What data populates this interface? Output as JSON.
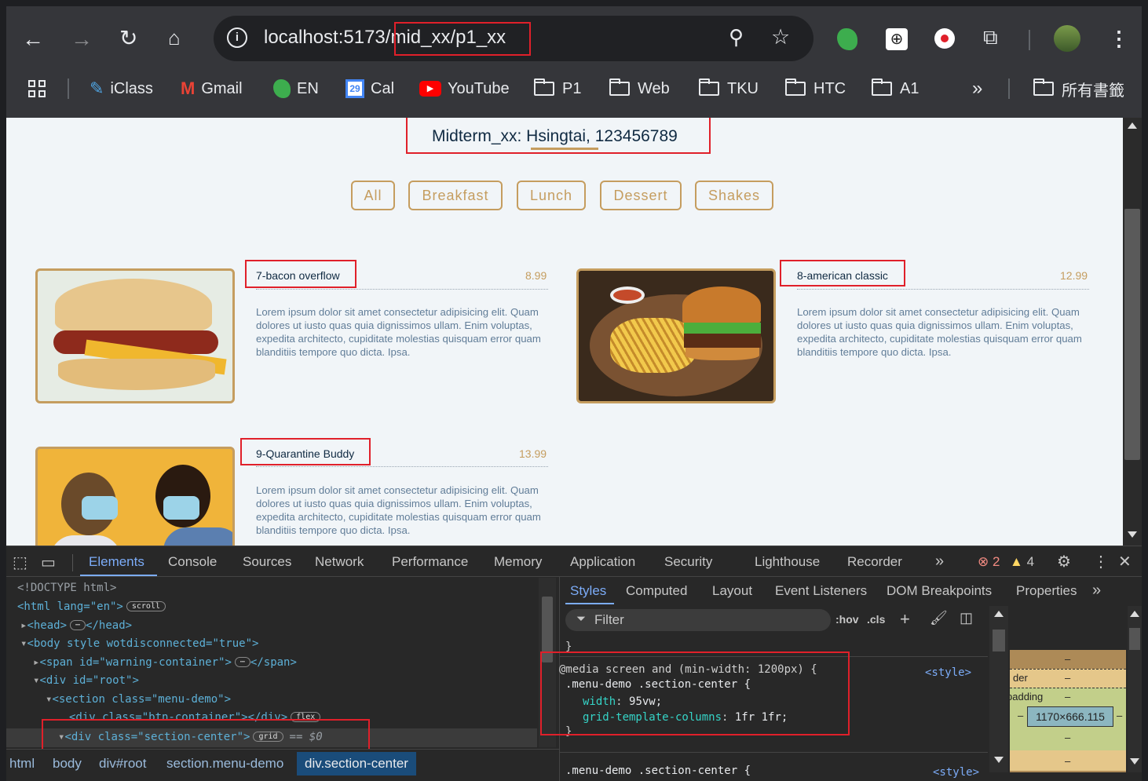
{
  "browser": {
    "url": "localhost:5173/mid_xx/p1_xx",
    "bookmarks": [
      {
        "label": "iClass",
        "icon": "iclass-icon"
      },
      {
        "label": "Gmail",
        "icon": "gmail-icon"
      },
      {
        "label": "EN",
        "icon": "evernote-icon"
      },
      {
        "label": "Cal",
        "icon": "calendar-icon",
        "badge": "29"
      },
      {
        "label": "YouTube",
        "icon": "youtube-icon"
      },
      {
        "label": "P1",
        "icon": "folder-icon"
      },
      {
        "label": "Web",
        "icon": "folder-icon"
      },
      {
        "label": "TKU",
        "icon": "folder-icon"
      },
      {
        "label": "HTC",
        "icon": "folder-icon"
      },
      {
        "label": "A1",
        "icon": "folder-icon"
      }
    ],
    "overflow": "»",
    "all_bookmarks": "所有書籤"
  },
  "page": {
    "title": "Midterm_xx: Hsingtai, 123456789",
    "filters": [
      "All",
      "Breakfast",
      "Lunch",
      "Dessert",
      "Shakes"
    ],
    "items": [
      {
        "title": "7-bacon overflow",
        "price": "8.99",
        "desc": "Lorem ipsum dolor sit amet consectetur adipisicing elit. Quam dolores ut iusto quas quia dignissimos ullam. Enim voluptas, expedita architecto, cupiditate molestias quisquam error quam blanditiis tempore quo dicta. Ipsa."
      },
      {
        "title": "8-american classic",
        "price": "12.99",
        "desc": "Lorem ipsum dolor sit amet consectetur adipisicing elit. Quam dolores ut iusto quas quia dignissimos ullam. Enim voluptas, expedita architecto, cupiditate molestias quisquam error quam blanditiis tempore quo dicta. Ipsa."
      },
      {
        "title": "9-Quarantine Buddy",
        "price": "13.99",
        "desc": "Lorem ipsum dolor sit amet consectetur adipisicing elit. Quam dolores ut iusto quas quia dignissimos ullam. Enim voluptas, expedita architecto, cupiditate molestias quisquam error quam blanditiis tempore quo dicta. Ipsa."
      }
    ]
  },
  "devtools": {
    "tabs": [
      "Elements",
      "Console",
      "Sources",
      "Network",
      "Performance",
      "Memory",
      "Application",
      "Security",
      "Lighthouse",
      "Recorder"
    ],
    "more": "»",
    "errors": "2",
    "warnings": "4",
    "dom": {
      "doctype": "<!DOCTYPE html>",
      "html_open": "<html lang=\"en\">",
      "scroll_pill": "scroll",
      "head": "<head>",
      "head_close": "</head>",
      "body_open": "<body style wotdisconnected=\"true\">",
      "span": "<span id=\"warning-container\">",
      "span_close": "</span>",
      "root": "<div id=\"root\">",
      "section": "<section class=\"menu-demo\">",
      "btn_container": "<div class=\"btn-container\"></div>",
      "flex_pill": "flex",
      "section_center": "<div class=\"section-center\">",
      "grid_pill": "grid",
      "eq": "== $0"
    },
    "breadcrumbs": [
      "html",
      "body",
      "div#root",
      "section.menu-demo",
      "div.section-center"
    ],
    "styles_tabs": [
      "Styles",
      "Computed",
      "Layout",
      "Event Listeners",
      "DOM Breakpoints",
      "Properties"
    ],
    "filter_placeholder": "Filter",
    "hov": ":hov",
    "cls": ".cls",
    "rule": {
      "media": "@media screen and (min-width: 1200px) {",
      "selector": ".menu-demo .section-center {",
      "source": "<style>",
      "p1_name": "width",
      "p1_value": "95vw;",
      "p2_name": "grid-template-columns",
      "p2_value": "1fr 1fr;",
      "next_selector": ".menu-demo .section-center {"
    },
    "boxmodel": {
      "border": "der",
      "padding": "padding",
      "dash": "–",
      "size": "1170×666.115"
    }
  }
}
